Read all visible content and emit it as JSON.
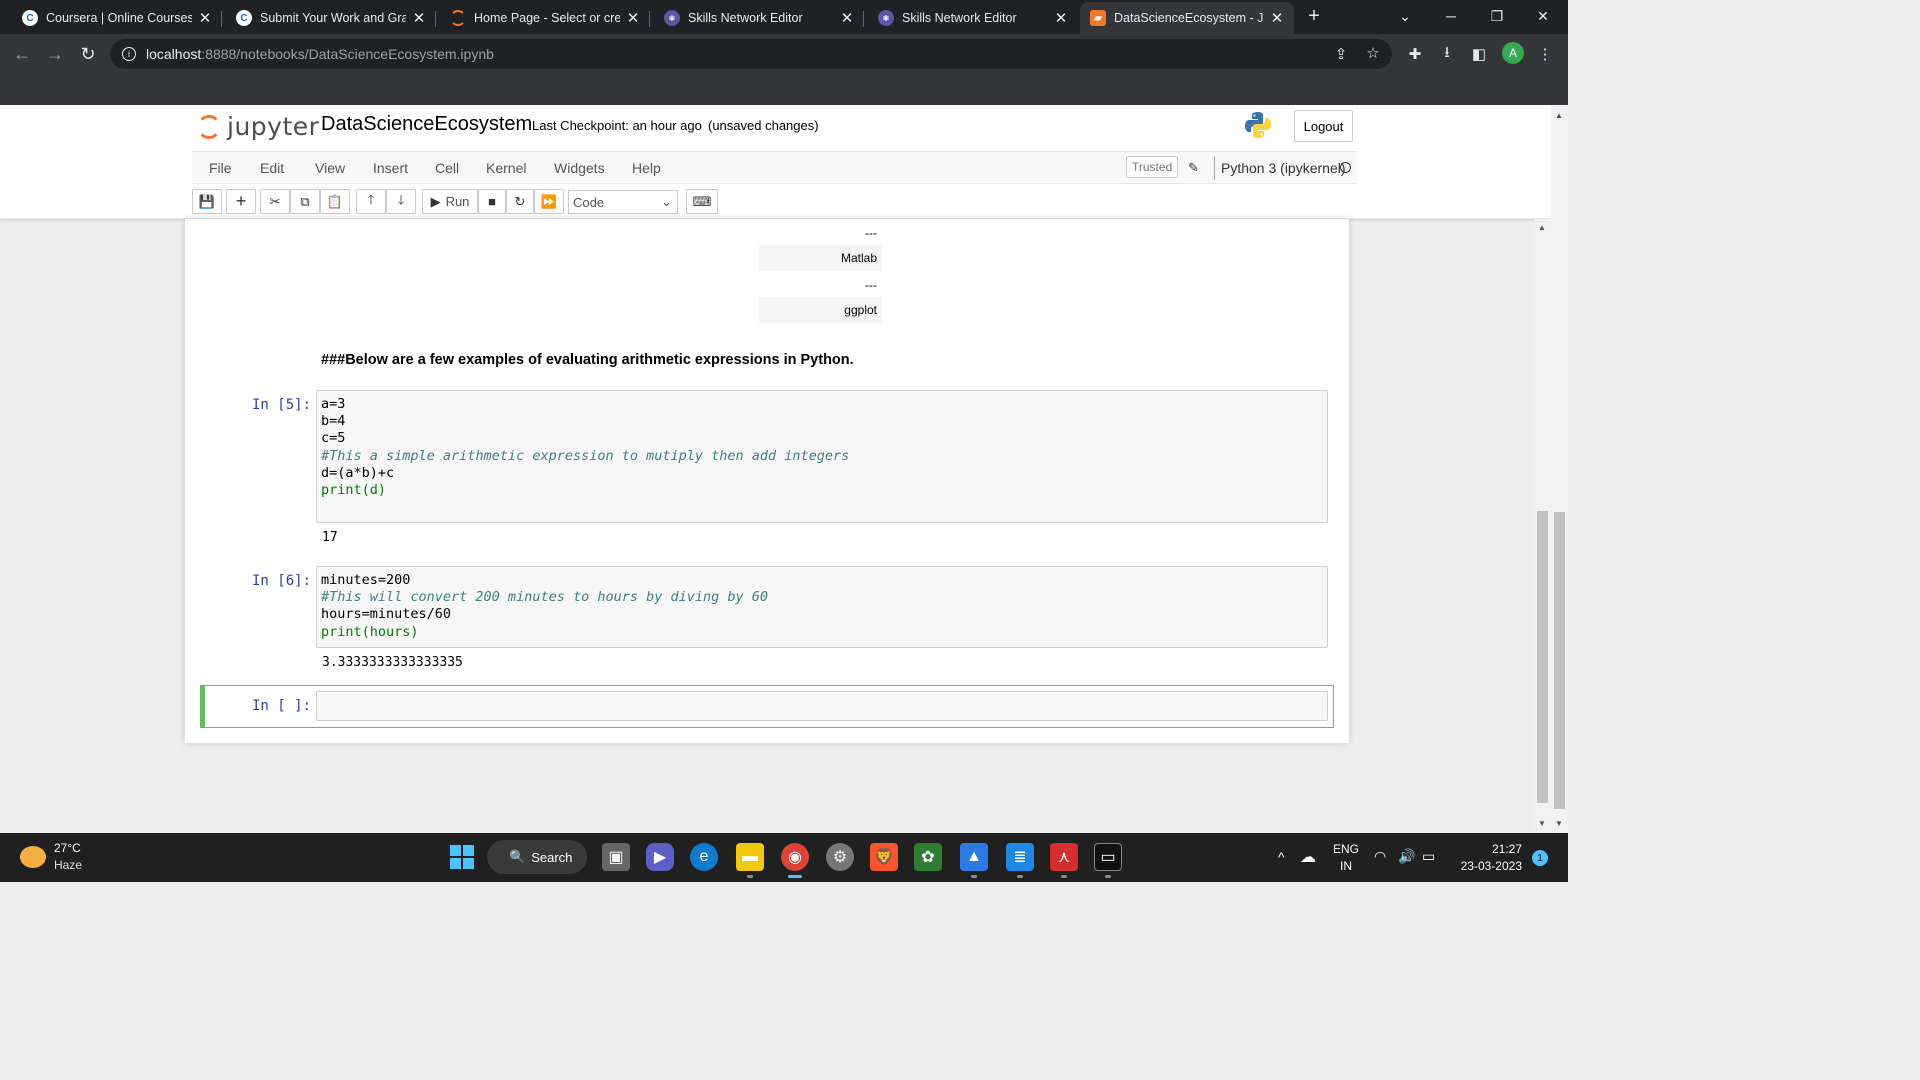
{
  "browser": {
    "tabs": [
      {
        "label": "Coursera | Online Courses &",
        "icon": "coursera-icon"
      },
      {
        "label": "Submit Your Work and Grac",
        "icon": "coursera-icon"
      },
      {
        "label": "Home Page - Select or creat",
        "icon": "jupyter-icon"
      },
      {
        "label": "Skills Network Editor",
        "icon": "skills-network-icon"
      },
      {
        "label": "Skills Network Editor",
        "icon": "skills-network-icon"
      },
      {
        "label": "DataScienceEcosystem - Ju",
        "icon": "notebook-icon",
        "active": true
      }
    ],
    "url_host": "localhost",
    "url_path": ":8888/notebooks/DataScienceEcosystem.ipynb",
    "profile_initial": "A"
  },
  "jupyter": {
    "logo_text": "jupyter",
    "notebook_name": "DataScienceEcosystem",
    "checkpoint": "Last Checkpoint: an hour ago",
    "unsaved": "(unsaved changes)",
    "logout_label": "Logout",
    "menu": [
      "File",
      "Edit",
      "View",
      "Insert",
      "Cell",
      "Kernel",
      "Widgets",
      "Help"
    ],
    "trusted_label": "Trusted",
    "kernel_name": "Python 3 (ipykernel)",
    "toolbar": {
      "run_label": "Run",
      "cell_type": "Code"
    }
  },
  "notebook": {
    "table_rows": [
      "---",
      "Matlab",
      "---",
      "ggplot"
    ],
    "markdown_heading": "###Below are a few examples of evaluating arithmetic expressions in Python.",
    "cells": [
      {
        "prompt": "In [5]:",
        "output": "17"
      },
      {
        "prompt": "In [6]:",
        "output": "3.3333333333333335"
      },
      {
        "prompt": "In [ ]:",
        "output": ""
      }
    ],
    "code_cell_5": {
      "line1": "a=3",
      "line2": "b=4",
      "line3": "c=5",
      "line4": "#This a simple arithmetic expression to mutiply then add integers",
      "line5": "d=(a*b)+c",
      "line6": "print(d)"
    },
    "code_cell_6": {
      "line1": "minutes=200",
      "line2": "#This will convert 200 minutes to hours by diving by 60",
      "line3": "hours=minutes/60",
      "line4": "print(hours)"
    }
  },
  "taskbar": {
    "temperature": "27°C",
    "weather": "Haze",
    "search_label": "Search",
    "lang1": "ENG",
    "lang2": "IN",
    "time": "21:27",
    "date": "23-03-2023",
    "notification_count": "1"
  }
}
